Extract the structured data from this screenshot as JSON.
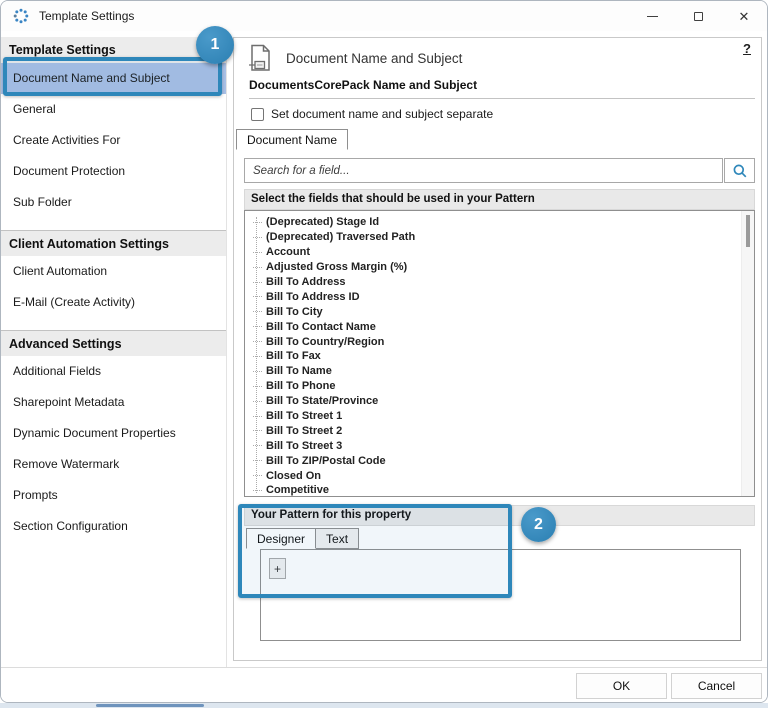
{
  "window": {
    "title": "Template Settings"
  },
  "sidebar": {
    "groups": [
      {
        "label": "Template Settings",
        "items": [
          {
            "label": "Document Name and Subject",
            "selected": true
          },
          {
            "label": "General",
            "selected": false
          },
          {
            "label": "Create Activities For",
            "selected": false
          },
          {
            "label": "Document Protection",
            "selected": false
          },
          {
            "label": "Sub Folder",
            "selected": false
          }
        ]
      },
      {
        "label": "Client Automation Settings",
        "items": [
          {
            "label": "Client Automation",
            "selected": false
          },
          {
            "label": "E-Mail (Create Activity)",
            "selected": false
          }
        ]
      },
      {
        "label": "Advanced Settings",
        "items": [
          {
            "label": "Additional Fields",
            "selected": false
          },
          {
            "label": "Sharepoint Metadata",
            "selected": false
          },
          {
            "label": "Dynamic Document Properties",
            "selected": false
          },
          {
            "label": "Remove Watermark",
            "selected": false
          },
          {
            "label": "Prompts",
            "selected": false
          },
          {
            "label": "Section Configuration",
            "selected": false
          }
        ]
      }
    ]
  },
  "main": {
    "header": {
      "title": "Document Name and Subject",
      "help_label": "?"
    },
    "section_title": "DocumentsCorePack Name and Subject",
    "checkbox_label": "Set document name and subject separate",
    "checkbox_checked": false,
    "tab_label": "Document Name",
    "search": {
      "placeholder": "Search for a field..."
    },
    "fields_header": "Select the fields that should be used in your Pattern",
    "fields": [
      "(Deprecated) Stage Id",
      "(Deprecated) Traversed Path",
      "Account",
      "Adjusted Gross Margin (%)",
      "Bill To Address",
      "Bill To Address ID",
      "Bill To City",
      "Bill To Contact Name",
      "Bill To Country/Region",
      "Bill To Fax",
      "Bill To Name",
      "Bill To Phone",
      "Bill To State/Province",
      "Bill To Street 1",
      "Bill To Street 2",
      "Bill To Street 3",
      "Bill To ZIP/Postal Code",
      "Closed On",
      "Competitive"
    ],
    "pattern": {
      "header": "Your Pattern for this property",
      "tabs": [
        "Designer",
        "Text"
      ],
      "add_button_label": "+"
    }
  },
  "footer": {
    "ok_label": "OK",
    "cancel_label": "Cancel"
  },
  "callouts": {
    "one": "1",
    "two": "2"
  },
  "colors": {
    "accent": "#2e87ba",
    "selection": "#a9c0e6",
    "band": "#e9e9e9"
  }
}
